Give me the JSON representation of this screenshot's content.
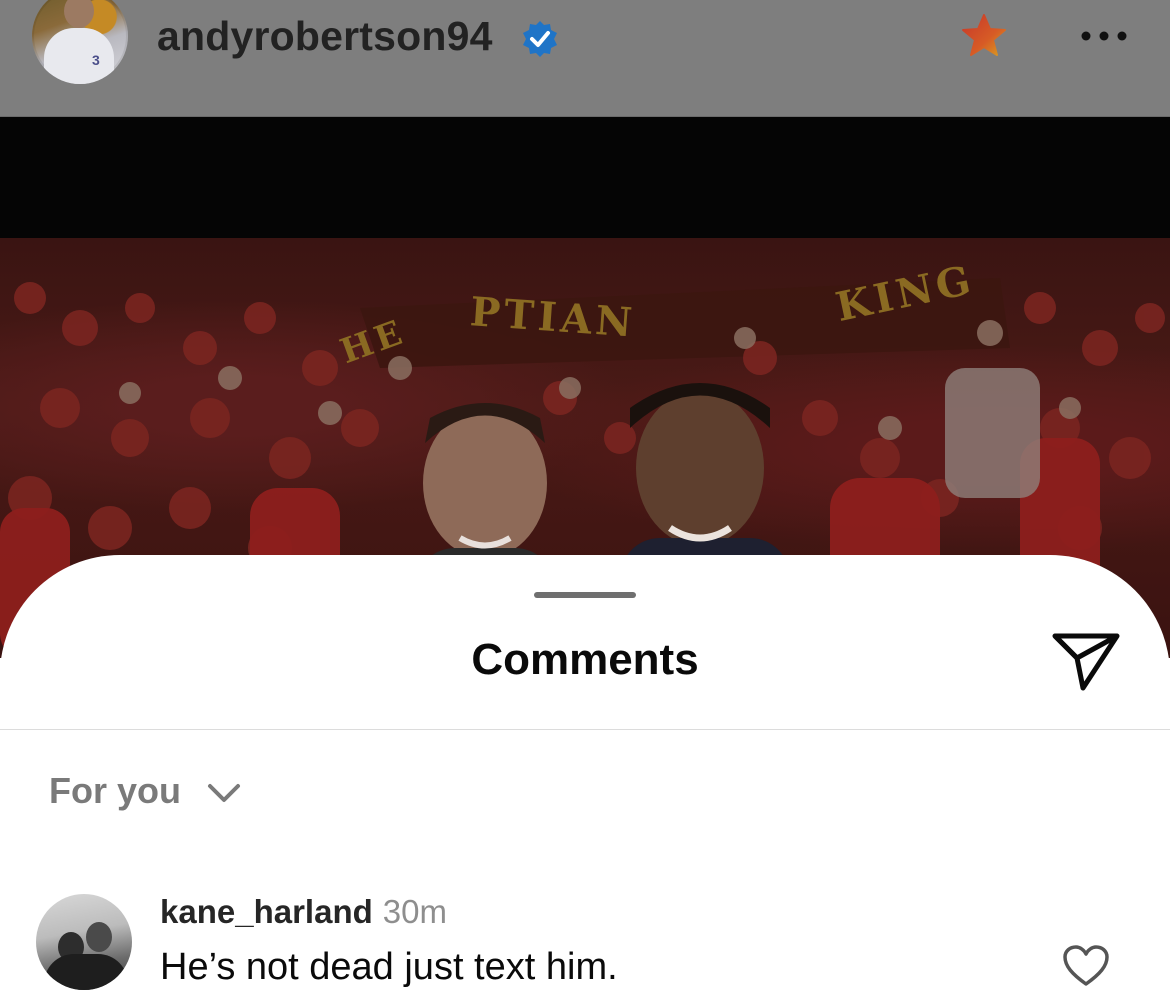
{
  "post_header": {
    "username": "andyrobertson94",
    "verified_icon": "verified-badge-icon",
    "favorite_icon": "star-icon",
    "more_icon": "more-options-icon",
    "avatar_jersey_number": "3"
  },
  "photo": {
    "banner_text_a": "PTIAN",
    "banner_text_b": "KING",
    "banner_text_c": "HE",
    "colors": {
      "crowd_red": "#b32020",
      "banner_gold": "#8a6a22"
    }
  },
  "comments_sheet": {
    "title": "Comments",
    "share_icon": "send-icon",
    "sort": {
      "label": "For you",
      "icon": "chevron-down-icon"
    },
    "comments": [
      {
        "username": "kane_harland",
        "time": "30m",
        "text": "He’s not dead just text him.",
        "like_icon": "heart-icon"
      }
    ]
  },
  "colors": {
    "verified_blue": "#1f74c7",
    "star_red": "#d23b27",
    "star_yellow": "#f4b11c",
    "text_primary": "#0a0a0a",
    "text_secondary": "#8e8e8e"
  }
}
